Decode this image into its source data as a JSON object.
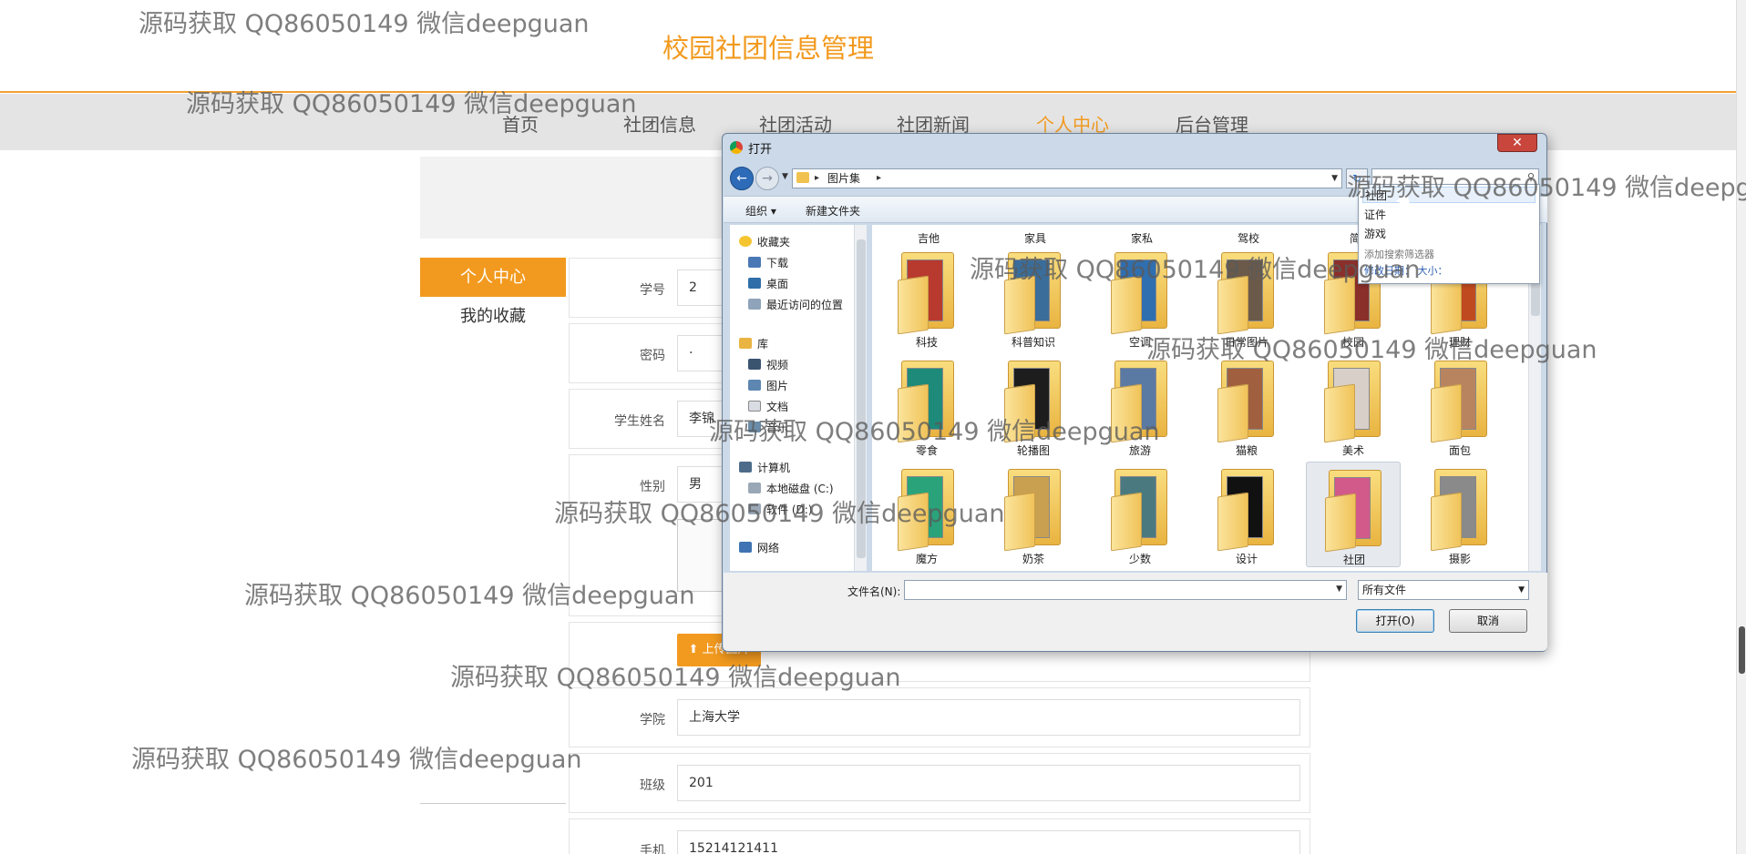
{
  "site": {
    "title": "校园社团信息管理",
    "nav": [
      "首页",
      "社团信息",
      "社团活动",
      "社团新闻",
      "个人中心",
      "后台管理"
    ],
    "active_nav": "个人中心"
  },
  "side_menu": [
    "个人中心",
    "我的收藏"
  ],
  "form": {
    "student_id_label": "学号",
    "student_id_value": "2",
    "password_label": "密码",
    "password_value": "·",
    "name_label": "学生姓名",
    "name_value": "李锦",
    "gender_label": "性别",
    "gender_value": "男",
    "upload_label": "上传图片",
    "college_label": "学院",
    "college_value": "上海大学",
    "class_label": "班级",
    "class_value": "201",
    "phone_label": "手机",
    "phone_value": "15214121411"
  },
  "dialog": {
    "title": "打开",
    "close": "✕",
    "breadcrumb": "图片集",
    "toolbar": {
      "organize": "组织 ▾",
      "new_folder": "新建文件夹"
    },
    "tree": {
      "favorites": "收藏夹",
      "favorite_items": [
        "下载",
        "桌面",
        "最近访问的位置"
      ],
      "libraries": "库",
      "library_items": [
        "视频",
        "图片",
        "文档",
        "音乐"
      ],
      "computer": "计算机",
      "computer_items": [
        "本地磁盘 (C:)",
        "软件 (D:)"
      ],
      "network": "网络"
    },
    "top_row": [
      "吉他",
      "家具",
      "家私",
      "驾校",
      "简"
    ],
    "folders": [
      {
        "name": "科技",
        "thumb": "#b83a2e"
      },
      {
        "name": "科普知识",
        "thumb": "#3a6d9a"
      },
      {
        "name": "空调",
        "thumb": "#2f6fb0"
      },
      {
        "name": "日常图片",
        "thumb": "#6b5a4a"
      },
      {
        "name": "校园",
        "thumb": "#8a2f2a"
      },
      {
        "name": "理财",
        "thumb": "#c04a20"
      },
      {
        "name": "零食",
        "thumb": "#1e8a7a"
      },
      {
        "name": "轮播图",
        "thumb": "#1d1d1d"
      },
      {
        "name": "旅游",
        "thumb": "#5b7aa3"
      },
      {
        "name": "猫粮",
        "thumb": "#a06040"
      },
      {
        "name": "美术",
        "thumb": "#d8d0c8"
      },
      {
        "name": "面包",
        "thumb": "#b88460"
      },
      {
        "name": "魔方",
        "thumb": "#2aa37a"
      },
      {
        "name": "奶茶",
        "thumb": "#c9a050"
      },
      {
        "name": "少数",
        "thumb": "#4a7a80"
      },
      {
        "name": "设计",
        "thumb": "#111111"
      },
      {
        "name": "社团",
        "thumb": "#d25a8a"
      },
      {
        "name": "摄影",
        "thumb": "#8a8a8a"
      }
    ],
    "selected_folder": "社团",
    "filename_label": "文件名(N):",
    "filetype_value": "所有文件",
    "open_button": "打开(O)",
    "cancel_button": "取消",
    "search_suggestions": [
      "社团",
      "证件",
      "游戏"
    ],
    "search_hint": "添加搜索筛选器",
    "search_link": "修改日期：  大小："
  },
  "watermark": "源码获取 QQ86050149 微信deepguan",
  "colors": {
    "accent": "#f29a1f",
    "nav_bg": "#e4e4e4"
  }
}
